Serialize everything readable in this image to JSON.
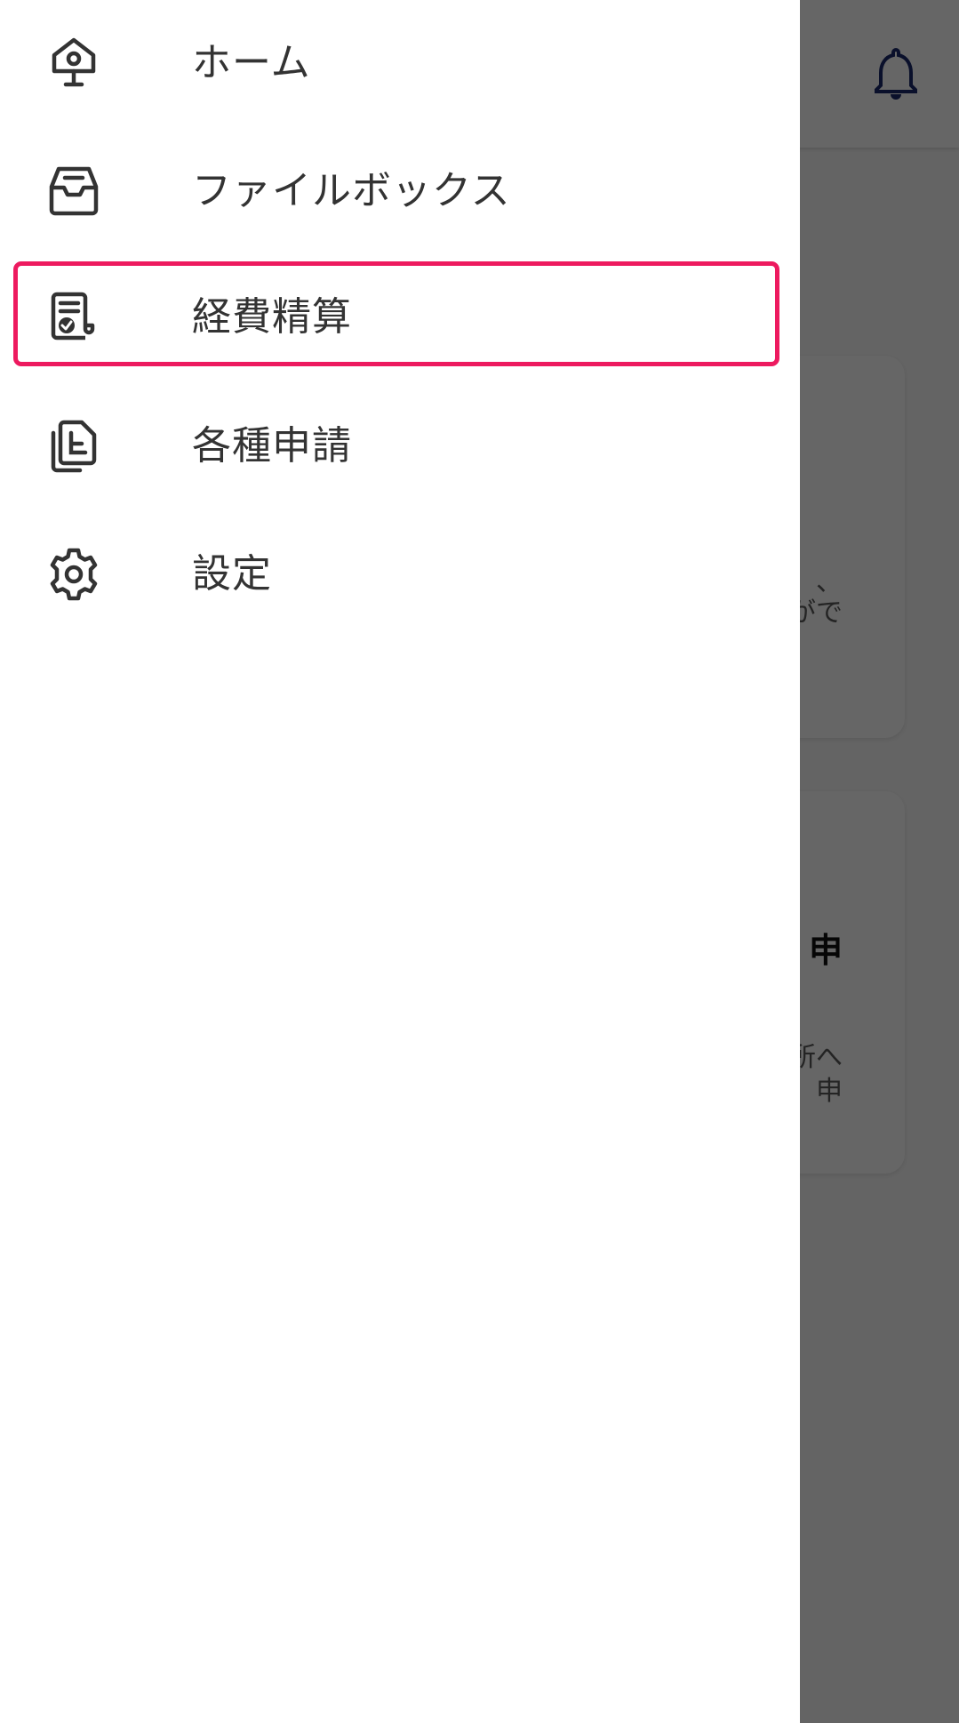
{
  "background": {
    "card1": {
      "text_lines": [
        "、",
        "がで"
      ]
    },
    "card2": {
      "title_fragment": "申",
      "text_lines": [
        "所へ",
        "申"
      ]
    }
  },
  "drawer": {
    "items": [
      {
        "label": "ホーム",
        "icon": "home-icon"
      },
      {
        "label": "ファイルボックス",
        "icon": "inbox-icon"
      },
      {
        "label": "経費精算",
        "icon": "receipt-icon",
        "highlighted": true
      },
      {
        "label": "各種申請",
        "icon": "documents-icon"
      },
      {
        "label": "設定",
        "icon": "gear-icon"
      }
    ]
  },
  "colors": {
    "highlight": "#ed1a5f",
    "bell": "#1a2a6c",
    "text": "#333333"
  }
}
